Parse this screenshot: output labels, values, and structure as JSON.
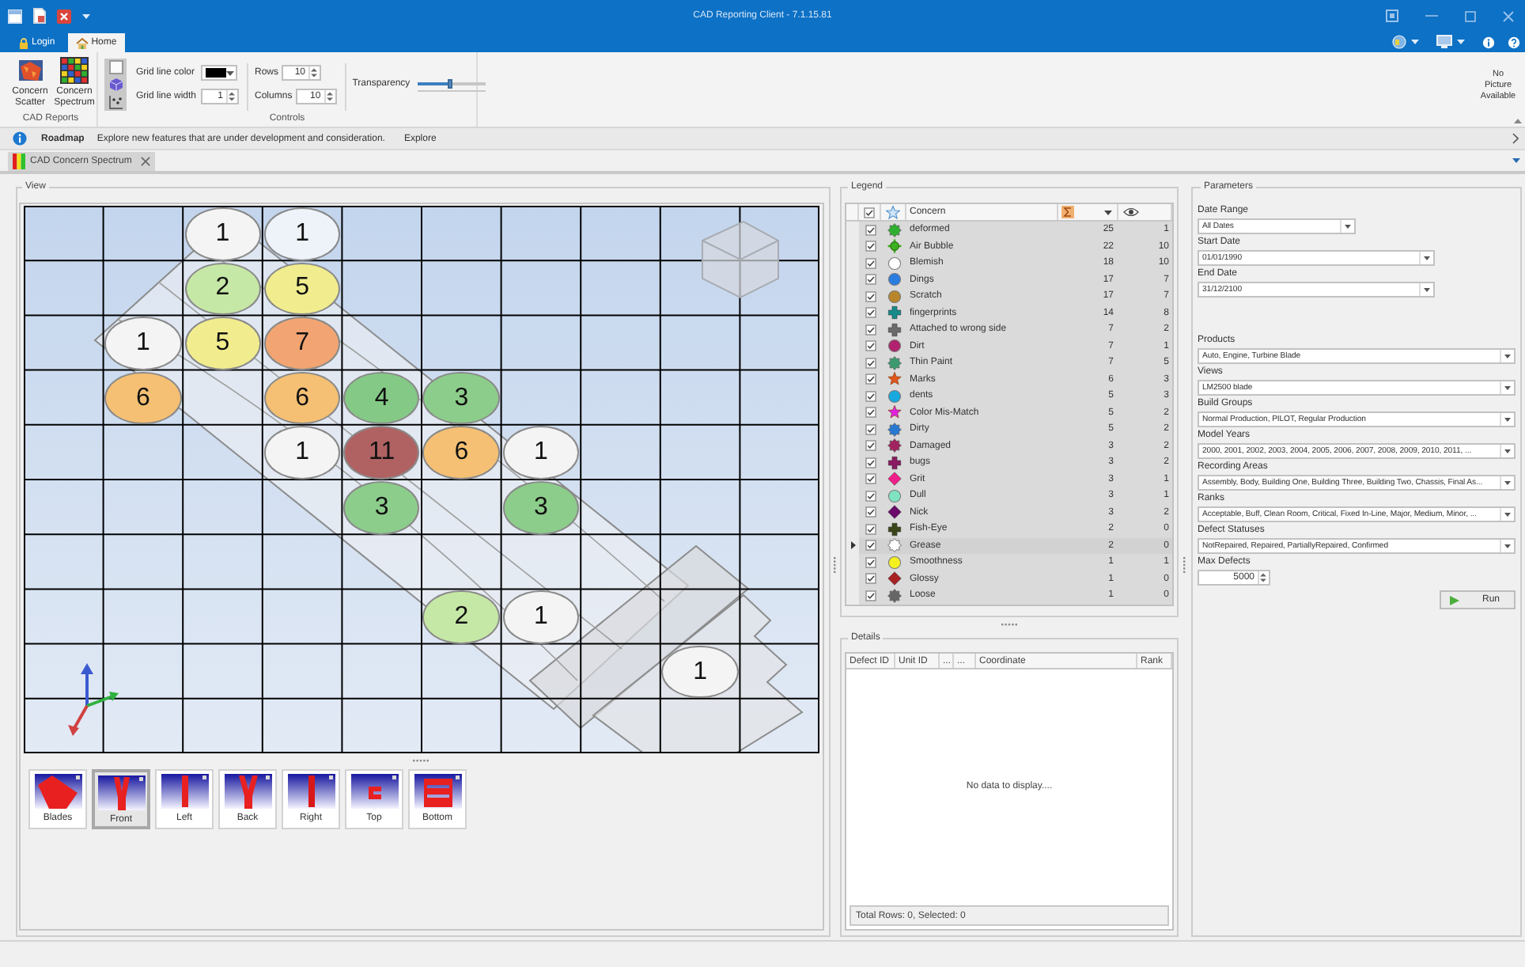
{
  "window": {
    "title": "CAD Reporting Client - 7.1.15.81"
  },
  "ribbon_tabs": [
    {
      "label": "Login",
      "selected": false
    },
    {
      "label": "Home",
      "selected": true
    }
  ],
  "ribbon": {
    "cad_reports": {
      "label": "CAD Reports",
      "buttons": [
        {
          "label": "Concern Scatter"
        },
        {
          "label": "Concern Spectrum"
        }
      ]
    },
    "controls": {
      "label": "Controls",
      "grid_line_color": {
        "label": "Grid line color",
        "color": "#000000"
      },
      "grid_line_width": {
        "label": "Grid line width",
        "value": "1"
      },
      "rows": {
        "label": "Rows",
        "value": "10"
      },
      "columns": {
        "label": "Columns",
        "value": "10"
      },
      "transparency": {
        "label": "Transparency",
        "level": 0.45
      }
    },
    "picture_note": "No Picture Available"
  },
  "info_bar": {
    "title": "Roadmap",
    "message": "Explore new features that are under development and consideration.",
    "link": "Explore"
  },
  "document_tabs": [
    {
      "label": "CAD Concern Spectrum",
      "selected": true
    }
  ],
  "view": {
    "title": "View",
    "grid": [
      [
        {
          "kind": "blank"
        },
        {
          "kind": "blank"
        },
        {
          "kind": "bubble",
          "count": "1",
          "color": "#f4f4f4"
        },
        {
          "kind": "bubble",
          "count": "1",
          "color": "#eef3fa"
        },
        {
          "kind": "blank"
        },
        {
          "kind": "blank"
        },
        {
          "kind": "blank"
        },
        {
          "kind": "blank"
        },
        {
          "kind": "blank"
        },
        {
          "kind": "blank"
        }
      ],
      [
        {
          "kind": "blank"
        },
        {
          "kind": "blank"
        },
        {
          "kind": "bubble",
          "count": "2",
          "color": "#c6e8a6"
        },
        {
          "kind": "bubble",
          "count": "5",
          "color": "#f1ed8e"
        },
        {
          "kind": "blank"
        },
        {
          "kind": "blank"
        },
        {
          "kind": "blank"
        },
        {
          "kind": "blank"
        },
        {
          "kind": "blank"
        },
        {
          "kind": "blank"
        }
      ],
      [
        {
          "kind": "blank"
        },
        {
          "kind": "bubble",
          "count": "1",
          "color": "#f4f4f4"
        },
        {
          "kind": "bubble",
          "count": "5",
          "color": "#f1ed8e"
        },
        {
          "kind": "bubble",
          "count": "7",
          "color": "#f2a572"
        },
        {
          "kind": "blank"
        },
        {
          "kind": "blank"
        },
        {
          "kind": "blank"
        },
        {
          "kind": "blank"
        },
        {
          "kind": "blank"
        },
        {
          "kind": "blank"
        }
      ],
      [
        {
          "kind": "blank"
        },
        {
          "kind": "bubble",
          "count": "6",
          "color": "#f5c073"
        },
        {
          "kind": "blank"
        },
        {
          "kind": "bubble",
          "count": "6",
          "color": "#f5c073"
        },
        {
          "kind": "bubble",
          "count": "4",
          "color": "#84c986"
        },
        {
          "kind": "bubble",
          "count": "3",
          "color": "#8dcd8b"
        },
        {
          "kind": "blank"
        },
        {
          "kind": "blank"
        },
        {
          "kind": "blank"
        },
        {
          "kind": "blank"
        }
      ],
      [
        {
          "kind": "blank"
        },
        {
          "kind": "blank"
        },
        {
          "kind": "blank"
        },
        {
          "kind": "bubble",
          "count": "1",
          "color": "#f4f4f4"
        },
        {
          "kind": "bubble",
          "count": "11",
          "color": "#b06262"
        },
        {
          "kind": "bubble",
          "count": "6",
          "color": "#f5c073"
        },
        {
          "kind": "bubble",
          "count": "1",
          "color": "#f4f4f4"
        },
        {
          "kind": "blank"
        },
        {
          "kind": "blank"
        },
        {
          "kind": "blank"
        }
      ],
      [
        {
          "kind": "blank"
        },
        {
          "kind": "blank"
        },
        {
          "kind": "blank"
        },
        {
          "kind": "blank"
        },
        {
          "kind": "bubble",
          "count": "3",
          "color": "#8dcd8b"
        },
        {
          "kind": "blank"
        },
        {
          "kind": "bubble",
          "count": "3",
          "color": "#8dcd8b"
        },
        {
          "kind": "blank"
        },
        {
          "kind": "blank"
        },
        {
          "kind": "blank"
        }
      ],
      [
        {
          "kind": "blank"
        },
        {
          "kind": "blank"
        },
        {
          "kind": "blank"
        },
        {
          "kind": "blank"
        },
        {
          "kind": "blank"
        },
        {
          "kind": "blank"
        },
        {
          "kind": "blank"
        },
        {
          "kind": "blank"
        },
        {
          "kind": "blank"
        },
        {
          "kind": "blank"
        }
      ],
      [
        {
          "kind": "blank"
        },
        {
          "kind": "blank"
        },
        {
          "kind": "blank"
        },
        {
          "kind": "blank"
        },
        {
          "kind": "blank"
        },
        {
          "kind": "bubble",
          "count": "2",
          "color": "#c6e8a6"
        },
        {
          "kind": "bubble",
          "count": "1",
          "color": "#f4f4f4"
        },
        {
          "kind": "blank"
        },
        {
          "kind": "blank"
        },
        {
          "kind": "blank"
        }
      ],
      [
        {
          "kind": "blank"
        },
        {
          "kind": "blank"
        },
        {
          "kind": "blank"
        },
        {
          "kind": "blank"
        },
        {
          "kind": "blank"
        },
        {
          "kind": "blank"
        },
        {
          "kind": "blank"
        },
        {
          "kind": "blank"
        },
        {
          "kind": "bubble",
          "count": "1",
          "color": "#f4f4f4"
        },
        {
          "kind": "blank"
        }
      ],
      [
        {
          "kind": "blank"
        },
        {
          "kind": "blank"
        },
        {
          "kind": "blank"
        },
        {
          "kind": "blank"
        },
        {
          "kind": "blank"
        },
        {
          "kind": "blank"
        },
        {
          "kind": "blank"
        },
        {
          "kind": "blank"
        },
        {
          "kind": "blank"
        },
        {
          "kind": "blank"
        }
      ]
    ],
    "thumbnails": [
      {
        "label": "Blades",
        "selected": false
      },
      {
        "label": "Front",
        "selected": true
      },
      {
        "label": "Left",
        "selected": false
      },
      {
        "label": "Back",
        "selected": false
      },
      {
        "label": "Right",
        "selected": false
      },
      {
        "label": "Top",
        "selected": false
      },
      {
        "label": "Bottom",
        "selected": false
      }
    ]
  },
  "legend": {
    "title": "Legend",
    "all_checked": true,
    "concern_header": "Concern",
    "rows": [
      {
        "kind": "gear",
        "color": "#2fae2f",
        "name": "deformed",
        "checked": true,
        "total": "25",
        "eye_count": "1",
        "selected": false
      },
      {
        "kind": "crosshair",
        "color": "#3cb01e",
        "name": "Air Bubble",
        "checked": true,
        "total": "22",
        "eye_count": "10",
        "selected": false
      },
      {
        "kind": "circle",
        "color": "#ffffff",
        "name": "Blemish",
        "checked": true,
        "total": "18",
        "eye_count": "10",
        "selected": false
      },
      {
        "kind": "circle",
        "color": "#2a7de0",
        "name": "Dings",
        "checked": true,
        "total": "17",
        "eye_count": "7",
        "selected": false
      },
      {
        "kind": "circle",
        "color": "#b8862a",
        "name": "Scratch",
        "checked": true,
        "total": "17",
        "eye_count": "7",
        "selected": false
      },
      {
        "kind": "plus",
        "color": "#178a8a",
        "name": "fingerprints",
        "checked": true,
        "total": "14",
        "eye_count": "8",
        "selected": false
      },
      {
        "kind": "plus",
        "color": "#6a6a6a",
        "name": "Attached to wrong side",
        "checked": true,
        "total": "7",
        "eye_count": "2",
        "selected": false
      },
      {
        "kind": "circle",
        "color": "#b0226e",
        "name": "Dirt",
        "checked": true,
        "total": "7",
        "eye_count": "1",
        "selected": false
      },
      {
        "kind": "gear",
        "color": "#3a9a6e",
        "name": "Thin Paint",
        "checked": true,
        "total": "7",
        "eye_count": "5",
        "selected": false
      },
      {
        "kind": "star",
        "color": "#e0561c",
        "name": "Marks",
        "checked": true,
        "total": "6",
        "eye_count": "3",
        "selected": false
      },
      {
        "kind": "circle",
        "color": "#18a8e0",
        "name": "dents",
        "checked": true,
        "total": "5",
        "eye_count": "3",
        "selected": false
      },
      {
        "kind": "star",
        "color": "#e022e0",
        "name": "Color Mis-Match",
        "checked": true,
        "total": "5",
        "eye_count": "2",
        "selected": false
      },
      {
        "kind": "gear",
        "color": "#2878d0",
        "name": "Dirty",
        "checked": true,
        "total": "5",
        "eye_count": "2",
        "selected": false
      },
      {
        "kind": "gear",
        "color": "#a0225e",
        "name": "Damaged",
        "checked": true,
        "total": "3",
        "eye_count": "2",
        "selected": false
      },
      {
        "kind": "plus",
        "color": "#8a1a62",
        "name": "bugs",
        "checked": true,
        "total": "3",
        "eye_count": "2",
        "selected": false
      },
      {
        "kind": "diamond",
        "color": "#f0208a",
        "name": "Grit",
        "checked": true,
        "total": "3",
        "eye_count": "1",
        "selected": false
      },
      {
        "kind": "circle",
        "color": "#7fe3c3",
        "name": "Dull",
        "checked": true,
        "total": "3",
        "eye_count": "1",
        "selected": false
      },
      {
        "kind": "diamond",
        "color": "#6a0a6a",
        "name": "Nick",
        "checked": true,
        "total": "3",
        "eye_count": "2",
        "selected": false
      },
      {
        "kind": "plus",
        "color": "#3a4618",
        "name": "Fish-Eye",
        "checked": true,
        "total": "2",
        "eye_count": "0",
        "selected": false
      },
      {
        "kind": "gear",
        "color": "#ffffff",
        "name": "Grease",
        "checked": true,
        "total": "2",
        "eye_count": "0",
        "selected": true
      },
      {
        "kind": "circle",
        "color": "#f4f020",
        "name": "Smoothness",
        "checked": true,
        "total": "1",
        "eye_count": "1",
        "selected": false
      },
      {
        "kind": "diamond",
        "color": "#a82222",
        "name": "Glossy",
        "checked": true,
        "total": "1",
        "eye_count": "0",
        "selected": false
      },
      {
        "kind": "gear",
        "color": "#666666",
        "name": "Loose",
        "checked": true,
        "total": "1",
        "eye_count": "0",
        "selected": false
      }
    ]
  },
  "details": {
    "title": "Details",
    "columns": [
      "Defect ID",
      "Unit ID",
      "...",
      "...",
      "Coordinate",
      "Rank"
    ],
    "empty_text": "No data to display....",
    "footer": "Total Rows: 0, Selected: 0"
  },
  "parameters": {
    "title": "Parameters",
    "fields": [
      {
        "kind": "select",
        "label": "Date Range",
        "value": "All Dates"
      },
      {
        "kind": "date",
        "label": "Start Date",
        "value": "01/01/1990"
      },
      {
        "kind": "date",
        "label": "End Date",
        "value": "31/12/2100"
      },
      {
        "kind": "multi",
        "label": "Products",
        "value": "Auto, Engine, Turbine Blade"
      },
      {
        "kind": "multi",
        "label": "Views",
        "value": "LM2500 blade"
      },
      {
        "kind": "multi",
        "label": "Build Groups",
        "value": "Normal Production, PILOT, Regular Production"
      },
      {
        "kind": "multi",
        "label": "Model Years",
        "value": "2000, 2001, 2002, 2003, 2004, 2005, 2006, 2007, 2008, 2009, 2010, 2011, ..."
      },
      {
        "kind": "multi",
        "label": "Recording Areas",
        "value": "Assembly, Body, Building One, Building Three, Building Two, Chassis, Final As..."
      },
      {
        "kind": "multi",
        "label": "Ranks",
        "value": "Acceptable, Buff, Clean Room, Critical, Fixed In-Line, Major, Medium, Minor, ..."
      },
      {
        "kind": "multi",
        "label": "Defect Statuses",
        "value": "NotRepaired, Repaired, PartiallyRepaired, Confirmed"
      },
      {
        "kind": "spinner",
        "label": "Max Defects",
        "value": "5000"
      }
    ],
    "run_button": "Run"
  }
}
